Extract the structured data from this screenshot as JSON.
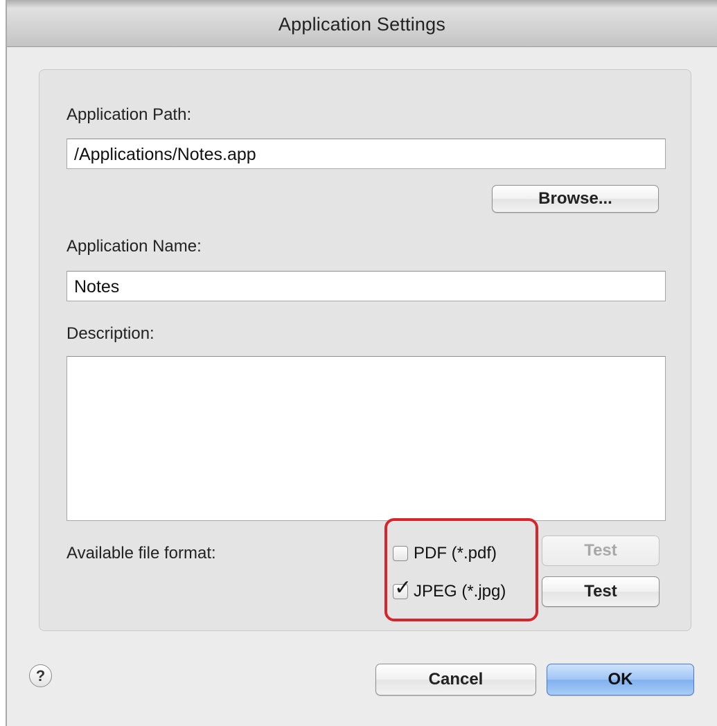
{
  "window": {
    "title": "Application Settings"
  },
  "form": {
    "path_label": "Application Path:",
    "path_value": "/Applications/Notes.app",
    "browse_label": "Browse...",
    "name_label": "Application Name:",
    "name_value": "Notes",
    "description_label": "Description:",
    "description_value": "",
    "formats_label": "Available file format:",
    "formats": [
      {
        "label": "PDF (*.pdf)",
        "checked": false,
        "test_label": "Test",
        "test_enabled": false
      },
      {
        "label": "JPEG (*.jpg)",
        "checked": true,
        "test_label": "Test",
        "test_enabled": true
      }
    ]
  },
  "footer": {
    "help_label": "?",
    "cancel_label": "Cancel",
    "ok_label": "OK"
  },
  "colors": {
    "highlight": "#d6262d",
    "default_button": "#7fb0ef"
  }
}
